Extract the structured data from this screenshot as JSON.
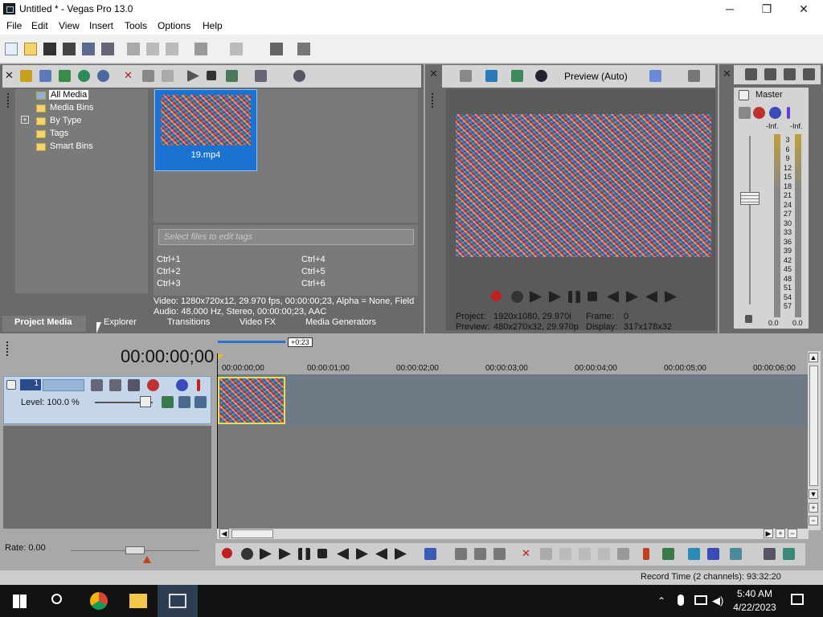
{
  "window": {
    "title": "Untitled * - Vegas Pro 13.0",
    "minimize": "─",
    "restore": "❐",
    "close": "✕"
  },
  "menu": [
    "File",
    "Edit",
    "View",
    "Insert",
    "Tools",
    "Options",
    "Help"
  ],
  "explorer": {
    "tree": [
      {
        "label": "All Media",
        "selected": true,
        "expand": ""
      },
      {
        "label": "Media Bins",
        "expand": ""
      },
      {
        "label": "By Type",
        "expand": "+"
      },
      {
        "label": "Tags",
        "expand": ""
      },
      {
        "label": "Smart Bins",
        "expand": ""
      }
    ],
    "media_item": "19.mp4",
    "tag_placeholder": "Select files to edit tags",
    "shortcuts": [
      "Ctrl+1",
      "Ctrl+4",
      "Ctrl+2",
      "Ctrl+5",
      "Ctrl+3",
      "Ctrl+6"
    ],
    "info_video": "Video: 1280x720x12, 29.970 fps, 00:00:00;23, Alpha = None, Field",
    "info_audio": "Audio: 48,000 Hz, Stereo, 00:00:00;23, AAC"
  },
  "tabs": [
    "Project Media",
    "Explorer",
    "Transitions",
    "Video FX",
    "Media Generators"
  ],
  "preview": {
    "mode": "Preview (Auto)",
    "project_label": "Project:",
    "project_value": "1920x1080, 29.970i",
    "frame_label": "Frame:",
    "frame_value": "0",
    "preview_label": "Preview:",
    "preview_value": "480x270x32, 29.970p",
    "display_label": "Display:",
    "display_value": "317x178x32"
  },
  "master": {
    "label": "Master",
    "inf_left": "-Inf.",
    "inf_right": "-Inf.",
    "scale": [
      "3",
      "6",
      "9",
      "12",
      "15",
      "18",
      "21",
      "24",
      "27",
      "30",
      "33",
      "36",
      "39",
      "42",
      "45",
      "48",
      "51",
      "54",
      "57"
    ],
    "bottom_left": "0.0",
    "bottom_right": "0.0"
  },
  "timeline": {
    "timecode": "00:00:00;00",
    "region_len": "+0:23",
    "ruler": [
      "00:00:00;00",
      "00:00:01;00",
      "00:00:02;00",
      "00:00:03;00",
      "00:00:04;00",
      "00:00:05;00",
      "00:00:06;00"
    ],
    "track_number": "1",
    "level": "Level: 100.0 %",
    "rate": "Rate: 0.00"
  },
  "status": {
    "record_time": "Record Time (2 channels): 93:32:20"
  },
  "taskbar": {
    "time": "5:40 AM",
    "date": "4/22/2023"
  },
  "colors": {
    "selection": "#1a73d0",
    "clip_border": "#e8e050",
    "track_header": "#c6d6ea"
  }
}
